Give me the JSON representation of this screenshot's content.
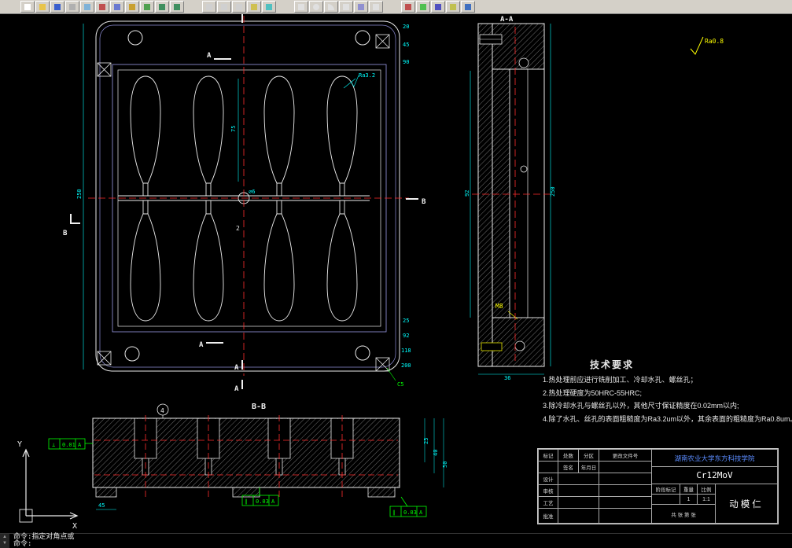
{
  "toolbar": {
    "icons": [
      "new",
      "open",
      "save",
      "print",
      "print-preview",
      "cut",
      "copy",
      "paste",
      "format-brush",
      "undo",
      "redo",
      "zoom-window",
      "zoom-in",
      "zoom-out",
      "pan",
      "regen",
      "line",
      "circle",
      "arc",
      "rectangle",
      "hatch",
      "text",
      "erase",
      "move",
      "rotate",
      "mirror",
      "help"
    ]
  },
  "dwg": {
    "main": {
      "a": "A",
      "b": "B",
      "dim75": "75",
      "dim250": "250",
      "rs": [
        "20",
        "45",
        "90",
        "25",
        "92",
        "118",
        "200"
      ],
      "gate": "∅6",
      "count": "2",
      "ra": "Ra3.2",
      "c5": "C5"
    },
    "side": {
      "label": "A-A",
      "right": "250",
      "left": "92",
      "bottom": "36",
      "m8": "M8"
    },
    "bb": {
      "label": "B-B",
      "balloon": "4",
      "r": [
        "25",
        "40",
        "50"
      ],
      "foot": "45"
    },
    "gdt": {
      "perp": "⊥",
      "par": "∥",
      "tol_perp": "0.01",
      "tol_par": "0.03",
      "ref": "A"
    },
    "corner_ra": "Ra0.8"
  },
  "tech": {
    "title": "技术要求",
    "items": [
      "1.热处理前应进行铣削加工、冷却水孔、螺丝孔；",
      "2.热处理硬度为50HRC-55HRC;",
      "3.除冷却水孔与螺丝孔以外，其他尺寸保证精度在0.02mm以内;",
      "4.除了水孔、丝孔的表面粗糙度为Ra3.2um以外，其余表面的粗糙度为Ra0.8um。"
    ]
  },
  "tb": {
    "school": "湖南农业大学东方科技学院",
    "material": "Cr12MoV",
    "part": "动模仁",
    "mark": "标记",
    "count": "处数",
    "zone": "分区",
    "change": "更改文件号",
    "sign": "签名",
    "date": "年月日",
    "design": "设计",
    "review": "审核",
    "process": "工艺",
    "approve": "批准",
    "stage": "阶段标记",
    "weight": "重量",
    "scale": "比例",
    "weight_v": "1",
    "scale_v": "1:1",
    "sheet": "共 张 第 张"
  },
  "axis": {
    "x": "X",
    "y": "Y"
  },
  "cmd": {
    "line1": "命令:指定对角点或",
    "line2": "命令:"
  }
}
